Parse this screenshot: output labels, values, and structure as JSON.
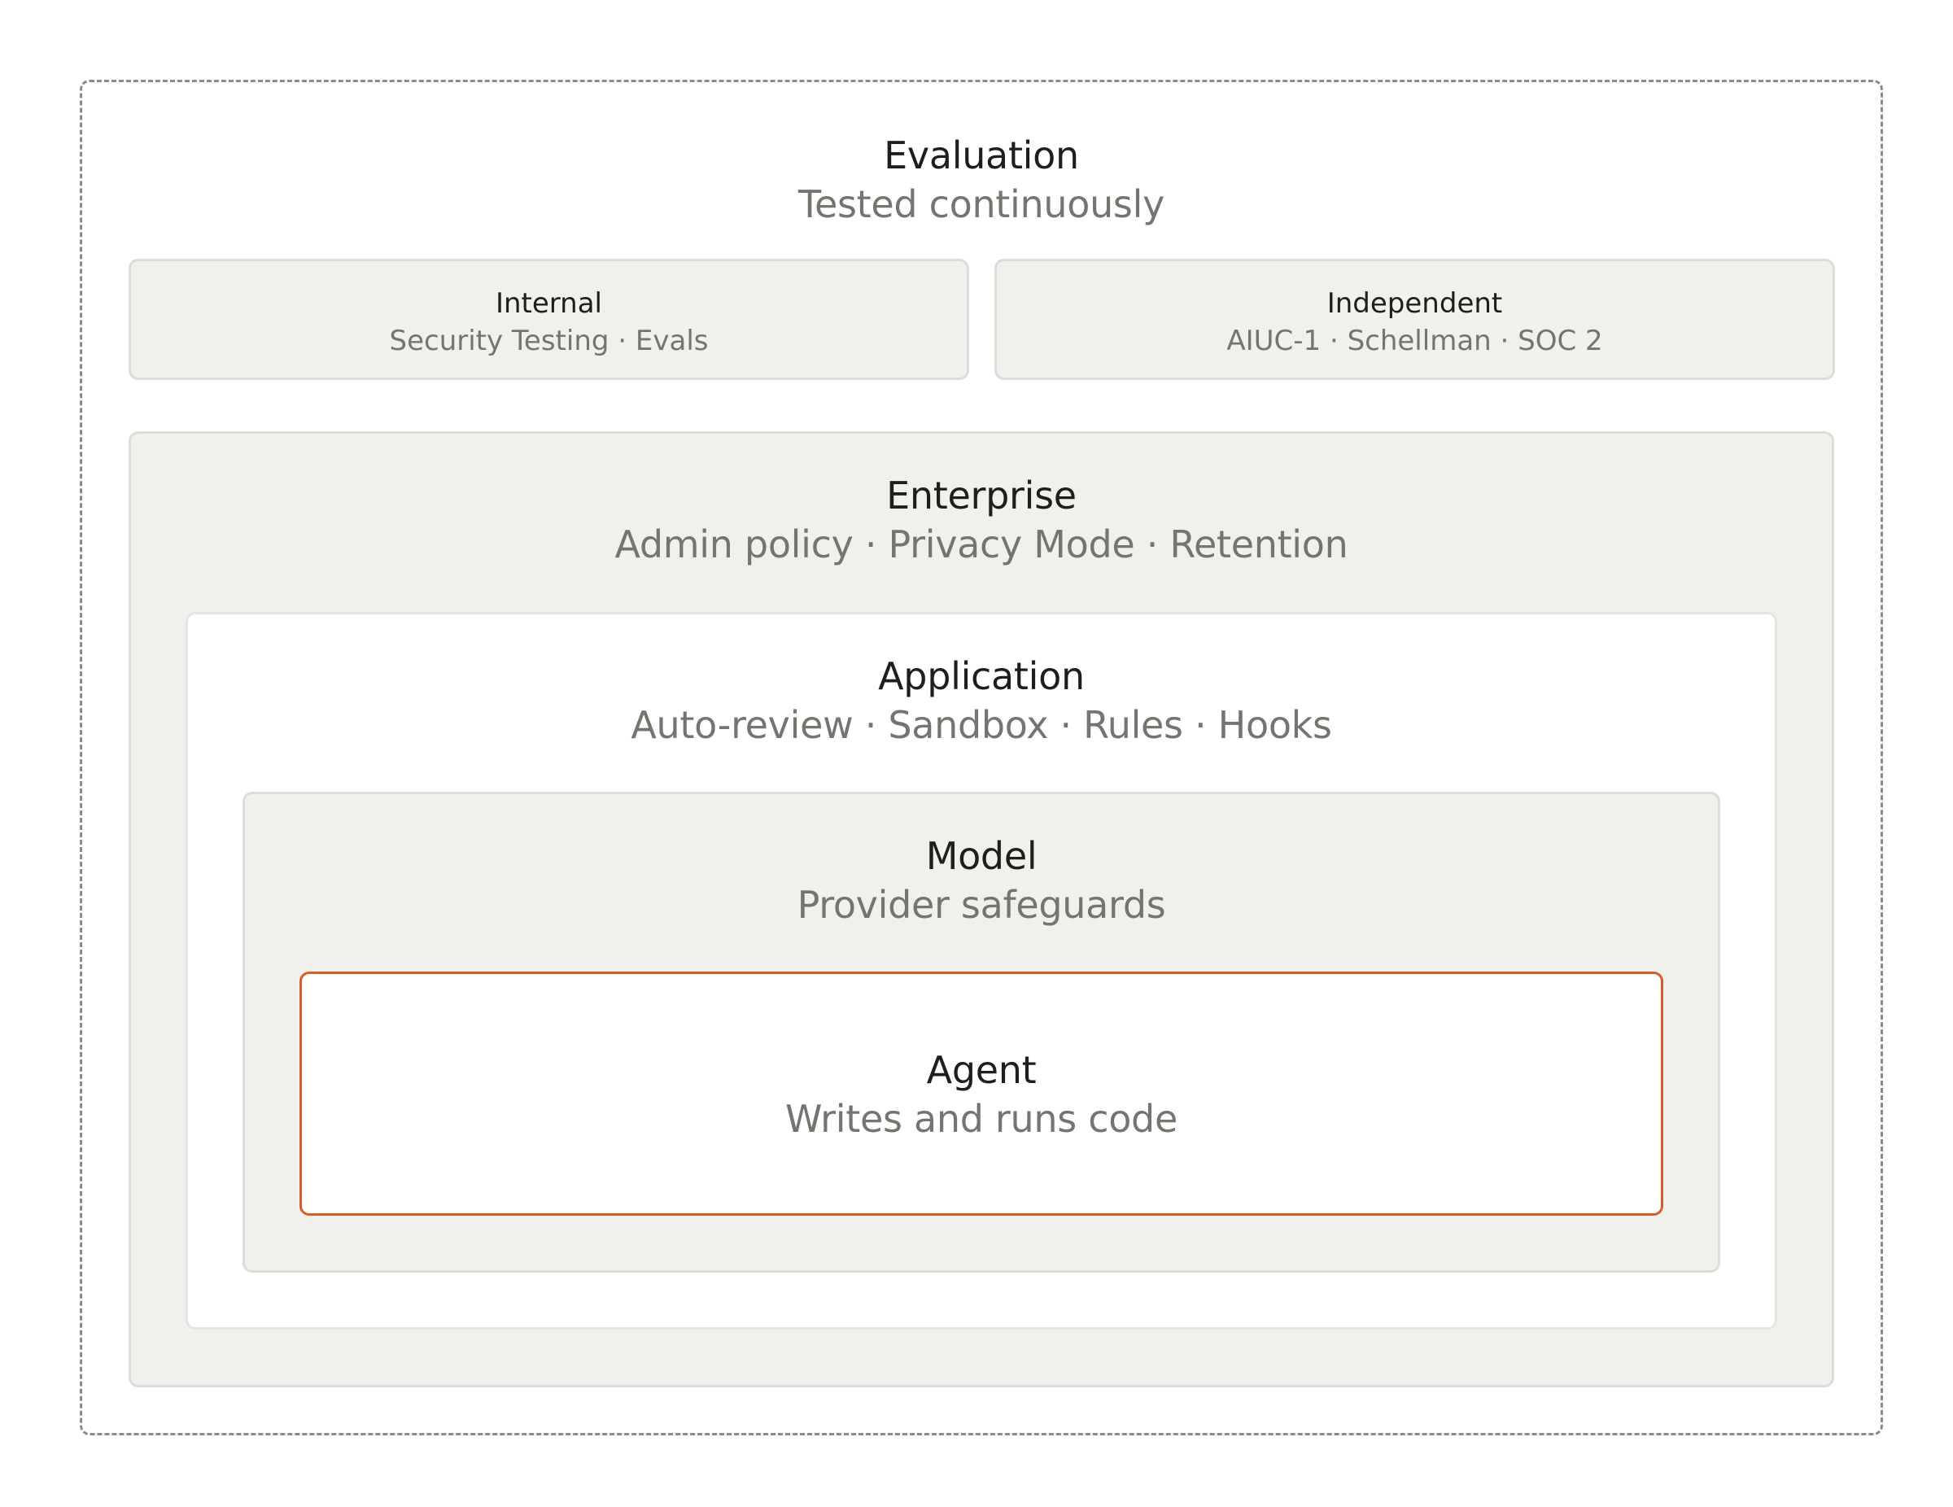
{
  "evaluation": {
    "title": "Evaluation",
    "subtitle": "Tested continuously",
    "internal": {
      "title": "Internal",
      "subtitle": "Security Testing · Evals"
    },
    "independent": {
      "title": "Independent",
      "subtitle": "AIUC-1 · Schellman · SOC 2"
    }
  },
  "enterprise": {
    "title": "Enterprise",
    "subtitle": "Admin policy · Privacy Mode · Retention"
  },
  "application": {
    "title": "Application",
    "subtitle": "Auto-review · Sandbox · Rules · Hooks"
  },
  "model": {
    "title": "Model",
    "subtitle": "Provider safeguards"
  },
  "agent": {
    "title": "Agent",
    "subtitle": "Writes and runs code"
  },
  "colors": {
    "frame_dash": "#8a8a86",
    "layer_fill": "#f1f0ed",
    "layer_border": "#dddcd8",
    "title_text": "#1f1e1c",
    "subtitle_text": "#76746f",
    "agent_accent": "#d95b2a"
  }
}
